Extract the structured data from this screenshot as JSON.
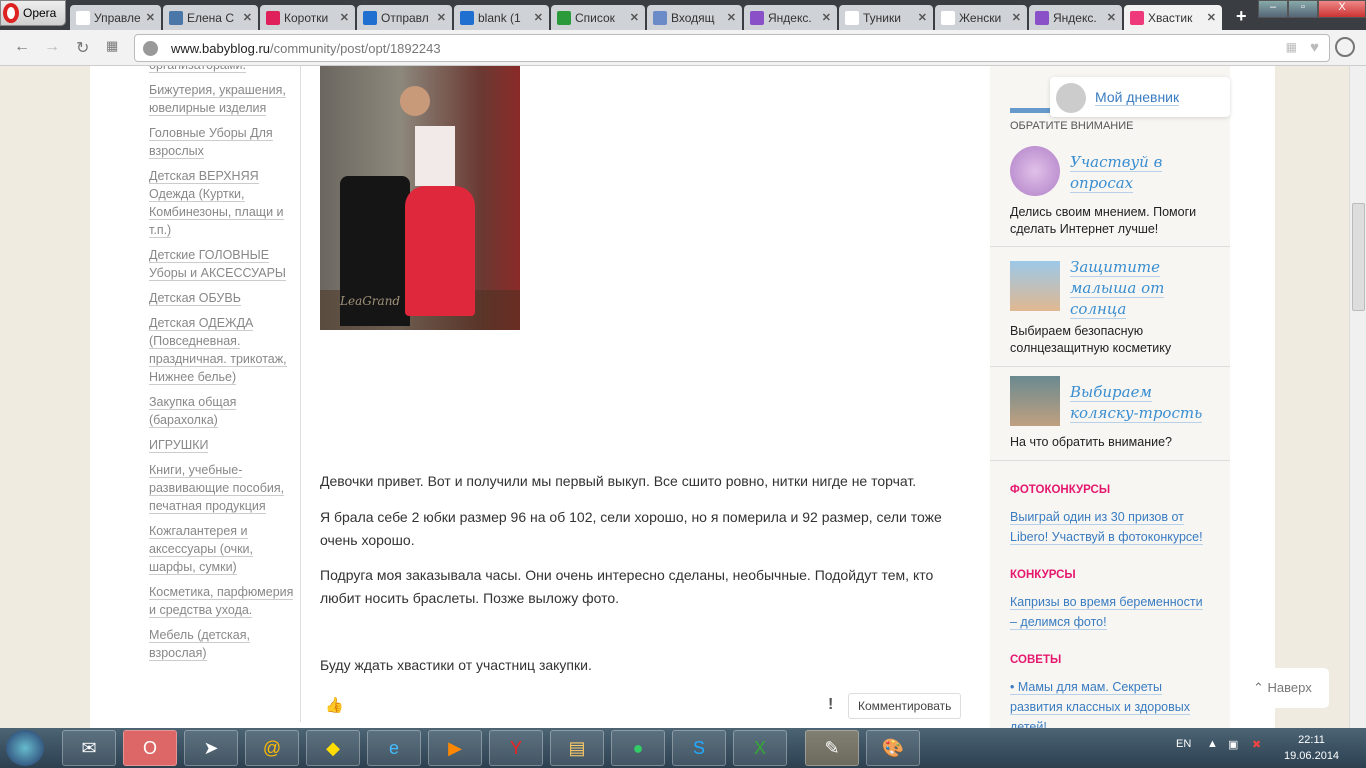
{
  "browser": {
    "menu_label": "Opera",
    "tabs": [
      {
        "title": "Управле",
        "color": "#fff"
      },
      {
        "title": "Елена С",
        "color": "#4a76a8"
      },
      {
        "title": "Коротки",
        "color": "#e0205a"
      },
      {
        "title": "Отправл",
        "color": "#1e6fd0"
      },
      {
        "title": "blank (1",
        "color": "#1e6fd0"
      },
      {
        "title": "Список",
        "color": "#2a9a3a"
      },
      {
        "title": "Входящ",
        "color": "#6a8ac8"
      },
      {
        "title": "Яндекс.",
        "color": "#8a50c8"
      },
      {
        "title": "Туники",
        "color": "#fff"
      },
      {
        "title": "Женски",
        "color": "#fff"
      },
      {
        "title": "Яндекс.",
        "color": "#8a50c8"
      },
      {
        "title": "Хвастик",
        "color": "#ee3a7a"
      }
    ],
    "url_domain": "www.babyblog.ru",
    "url_path": "/community/post/opt/1892243"
  },
  "sidebar": {
    "items": [
      "организаторами.",
      "Бижутерия, украшения, ювелирные изделия",
      "Головные Уборы Для взрослых",
      "Детская ВЕРХНЯЯ Одежда (Куртки, Комбинезоны, плащи и т.п.)",
      "Детские ГОЛОВНЫЕ Уборы и АКСЕССУАРЫ",
      "Детская ОБУВЬ",
      "Детская ОДЕЖДА (Повседневная. праздничная. трикотаж, Нижнее белье)",
      "Закупка общая (барахолка)",
      "ИГРУШКИ",
      "Книги, учебные-развивающие пособия, печатная продукция",
      "Кожгалантерея и аксессуары (очки, шарфы, сумки)",
      "Косметика, парфюмерия и средства ухода.",
      "Мебель (детская, взрослая)"
    ]
  },
  "post": {
    "paragraphs": [
      "Девочки привет. Вот и получили мы первый выкуп. Все сшито ровно, нитки нигде не торчат.",
      "Я брала себе 2 юбки размер 96 на об 102, сели хорошо, но я померила и 92 размер, сели тоже очень хорошо.",
      "Подруга моя заказывала часы. Они очень интересно сделаны, необычные. Подойдут тем, кто любит носить браслеты. Позже выложу фото.",
      "Буду ждать хвастики от участниц закупки."
    ],
    "exclaim": "!",
    "comment_label": "Комментировать",
    "photo_signature": "LeaGrand"
  },
  "right": {
    "diary_label": "Мой дневник",
    "attention_title": "ОБРАТИТЕ ВНИМАНИЕ",
    "items": [
      {
        "title": "Участвуй в опросах",
        "desc": "Делись своим мнением. Помоги сделать Интернет лучше!"
      },
      {
        "title": "Защитите малыша от солнца",
        "desc": "Выбираем безопасную солнцезащитную косметику"
      },
      {
        "title": "Выбираем коляску-трость",
        "desc": "На что обратить внимание?"
      }
    ],
    "sections": [
      {
        "title": "ФОТОКОНКУРСЫ",
        "link": "Выиграй один из 30 призов от Libero! Участвуй в фотоконкурсе!"
      },
      {
        "title": "КОНКУРСЫ",
        "link": "Капризы во время беременности – делимся фото!"
      },
      {
        "title": "СОВЕТЫ",
        "link": "• Мамы для мам. Секреты развития классных и здоровых детей!"
      }
    ],
    "accent": "#e5186e"
  },
  "to_top_label": "Наверх",
  "taskbar": {
    "lang": "EN",
    "time": "22:11",
    "date": "19.06.2014"
  }
}
